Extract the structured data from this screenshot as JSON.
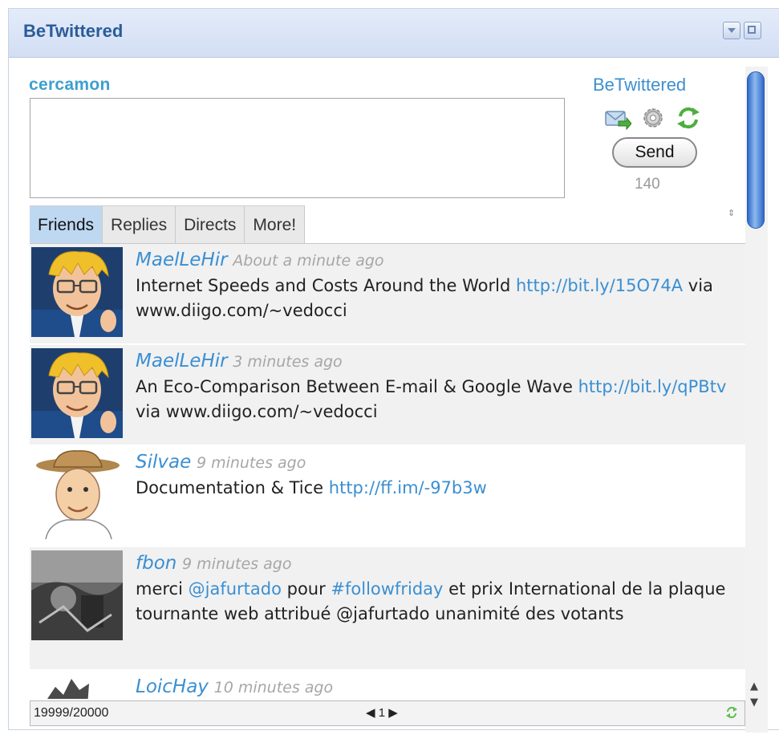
{
  "app": {
    "title": "BeTwittered",
    "brand_link": "BeTwittered"
  },
  "window_controls": [
    {
      "name": "minimize",
      "icon": "dropdown-icon"
    },
    {
      "name": "maximize",
      "icon": "maximize-icon"
    }
  ],
  "compose": {
    "username": "cercamon",
    "text": "",
    "send_label": "Send",
    "char_count": "140",
    "icons": [
      "mail-icon",
      "gear-icon",
      "refresh-icon"
    ]
  },
  "tabs": [
    {
      "label": "Friends",
      "active": true
    },
    {
      "label": "Replies",
      "active": false
    },
    {
      "label": "Directs",
      "active": false
    },
    {
      "label": "More!",
      "active": false
    }
  ],
  "tweets": [
    {
      "author": "MaelLeHir",
      "time": "About a minute ago",
      "parts": [
        {
          "t": "Internet Speeds and Costs Around the World ",
          "link": false
        },
        {
          "t": "http://bit.ly/15O74A",
          "link": true
        },
        {
          "t": " via www.diigo.com/~vedocci",
          "link": false
        }
      ]
    },
    {
      "author": "MaelLeHir",
      "time": "3 minutes ago",
      "parts": [
        {
          "t": "An Eco-Comparison Between E-mail & Google Wave ",
          "link": false
        },
        {
          "t": "http://bit.ly/qPBtv",
          "link": true
        },
        {
          "t": " via www.diigo.com/~vedocci",
          "link": false
        }
      ]
    },
    {
      "author": "Silvae",
      "time": "9 minutes ago",
      "parts": [
        {
          "t": "Documentation & Tice ",
          "link": false
        },
        {
          "t": "http://ff.im/-97b3w",
          "link": true
        }
      ]
    },
    {
      "author": "fbon",
      "time": "9 minutes ago",
      "parts": [
        {
          "t": "merci ",
          "link": false
        },
        {
          "t": "@jafurtado",
          "link": true
        },
        {
          "t": " pour ",
          "link": false
        },
        {
          "t": "#followfriday",
          "link": true
        },
        {
          "t": " et prix International de la plaque tournante web attribué @jafurtado unanimité des votants",
          "link": false
        }
      ]
    },
    {
      "author": "LoicHay",
      "time": "10 minutes ago",
      "parts": []
    }
  ],
  "status": {
    "quota": "19999/20000",
    "page": "1",
    "prev_icon": "prev-arrow-icon",
    "next_icon": "next-arrow-icon"
  },
  "colors": {
    "accent": "#3a8fd2",
    "title_bar": "#d9e4f7",
    "active_tab": "#bed8f2"
  }
}
